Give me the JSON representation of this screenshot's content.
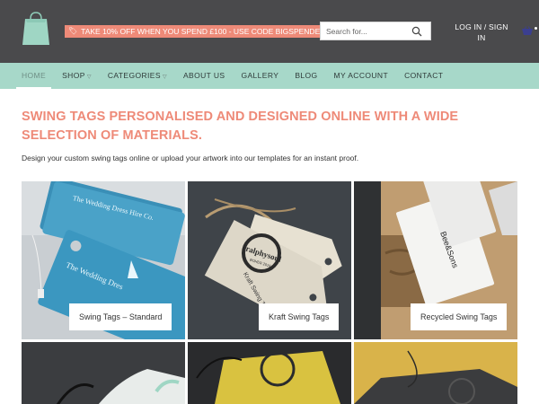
{
  "header": {
    "promo_text": "TAKE 10% OFF WHEN YOU SPEND £100 - USE CODE BIGSPENDER",
    "search_placeholder": "Search for...",
    "login_label": "LOG IN / SIGN IN"
  },
  "nav": {
    "items": [
      {
        "label": "HOME",
        "active": true
      },
      {
        "label": "SHOP",
        "dropdown": true
      },
      {
        "label": "CATEGORIES",
        "dropdown": true
      },
      {
        "label": "ABOUT US"
      },
      {
        "label": "GALLERY"
      },
      {
        "label": "BLOG"
      },
      {
        "label": "MY ACCOUNT"
      },
      {
        "label": "CONTACT"
      }
    ]
  },
  "main": {
    "title": "SWING TAGS PERSONALISED AND DESIGNED ONLINE WITH A WIDE SELECTION OF MATERIALS.",
    "intro": "Design your custom swing tags online or upload your artwork into our templates for an instant proof.",
    "products": [
      {
        "label": "Swing Tags – Standard"
      },
      {
        "label": "Kraft Swing Tags"
      },
      {
        "label": "Recycled Swing Tags"
      }
    ],
    "tile_texts": {
      "wedding_brand": "The Wedding Dress Hire Co.",
      "wedding_brand_short": "The Wedding Dres",
      "stamp_text": "ralphysoul",
      "stamp_sub": "BOHER 2019",
      "kraft_text": "Kraft Swing Tags",
      "bee_text": "Bee&Sons"
    }
  },
  "colors": {
    "header_bg": "#4a4a4c",
    "nav_bg": "#a7d8c9",
    "accent": "#ee8a78"
  }
}
